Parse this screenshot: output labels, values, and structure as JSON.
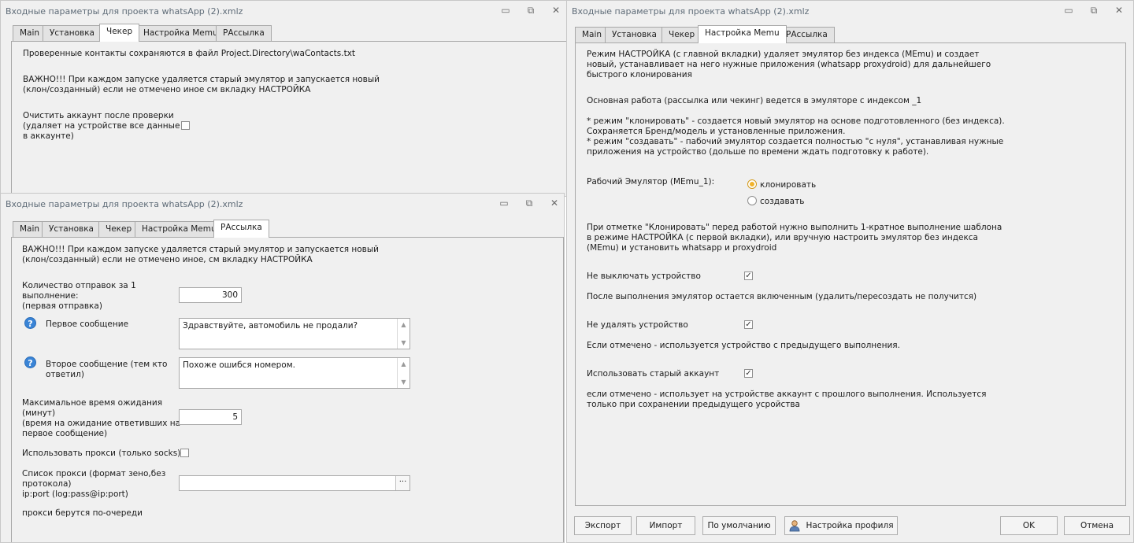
{
  "tabs": [
    "Main",
    "Установка",
    "Чекер",
    "Настройка Memu",
    "РАссылка"
  ],
  "window_controls": {
    "minimize": "▭",
    "maximize": "⧉",
    "close": "✕"
  },
  "win1": {
    "title": "Входные параметры для проекта whatsApp (2).xmlz",
    "active_tab": "Чекер",
    "text1": "Проверенные контакты сохраняются в файл Project.Directory\\waContacts.txt",
    "warn1": "ВАЖНО!!! При каждом запуске удаляется старый эмулятор и запускается новый",
    "warn2": "(клон/созданный) если не отмечено иное см вкладку НАСТРОЙКА",
    "clear1": "Очистить аккаунт после проверки",
    "clear2": "(удаляет на устройстве все данные",
    "clear3": "в аккаунте)",
    "clear_checked": false
  },
  "win2": {
    "title": "Входные параметры для проекта whatsApp (2).xmlz",
    "active_tab": "РАссылка",
    "warn1": "ВАЖНО!!! При каждом запуске удаляется старый эмулятор и запускается новый",
    "warn2": "(клон/созданный) если не отмечено иное, см вкладку НАСТРОЙКА",
    "count_l1": "Количество отправок за 1",
    "count_l2": "выполнение:",
    "count_l3": "(первая отправка)",
    "count_value": "300",
    "first_label": "Первое сообщение",
    "first_value": "Здравствуйте, автомобиль не продали?",
    "second_l1": "Второе сообщение (тем кто",
    "second_l2": "ответил)",
    "second_value": "Похоже ошибся номером.",
    "wait_l1": "Максимальное время ожидания",
    "wait_l2": "(минут)",
    "wait_l3": "(время на ожидание ответивших на",
    "wait_l4": "первое сообщение)",
    "wait_value": "5",
    "proxy_use": "Использовать прокси (только socks)",
    "proxy_use_checked": false,
    "proxy_list_l1": "Список прокси (формат зено,без",
    "proxy_list_l2": "протокола)",
    "proxy_list_l3": "ip:port (log:pass@ip:port)",
    "proxy_value": "",
    "proxy_note": "прокси берутся по-очереди",
    "ellipsis": "···",
    "help_glyph": "?"
  },
  "win3": {
    "title": "Входные параметры для проекта whatsApp (2).xmlz",
    "active_tab": "Настройка Memu",
    "p1_1": "Режим НАСТРОЙКА (с главной вкладки) удаляет эмулятор без индекса (MEmu) и создает",
    "p1_2": "новый, устанавливает на него нужные приложения (whatsapp proxydroid) для дальнейшего",
    "p1_3": "быстрого клонирования",
    "p2": "Основная работа (рассылка или чекинг) ведется в эмуляторе с индексом _1",
    "p3_1": "* режим \"клонировать\" - создается новый эмулятор на основе подготовленного (без индекса).",
    "p3_2": "Сохраняется Бренд/модель и установленные приложения.",
    "p3_3": "* режим \"создавать\" - пабочий эмулятор создается полностью \"с нуля\", устанавливая нужные",
    "p3_4": "приложения на устройство (дольше по времени ждать подготовку к работе).",
    "emu_label": "Рабочий Эмулятор (MEmu_1):",
    "opt_clone": "клонировать",
    "opt_create": "создавать",
    "selected_option": "клонировать",
    "p4_1": "При отметке \"Клонировать\" перед работой нужно выполнить 1-кратное выполнение шаблона",
    "p4_2": "в режиме НАСТРОЙКА (с первой вкладки), или вручную настроить эмулятор без индекса",
    "p4_3": "(MEmu) и установить whatsapp и proxydroid",
    "no_off_label": "Не выключать устройство",
    "no_off_checked": true,
    "no_off_note": "После выполнения эмулятор остается включенным (удалить/пересоздать не получится)",
    "no_del_label": "Не удалять устройство",
    "no_del_checked": true,
    "no_del_note": "Если отмечено - используется устройство с предыдущего выполнения.",
    "old_acc_label": "Использовать старый аккаунт",
    "old_acc_checked": true,
    "old_acc_note1": "если отмечено - использует на устройстве аккаунт с прошлого выполнения. Используется",
    "old_acc_note2": "только при сохранении предыдущего усройства",
    "check_glyph": "✓",
    "buttons": {
      "export": "Экспорт",
      "import": "Импорт",
      "default": "По умолчанию",
      "profile": "Настройка профиля",
      "ok": "OK",
      "cancel": "Отмена"
    }
  }
}
